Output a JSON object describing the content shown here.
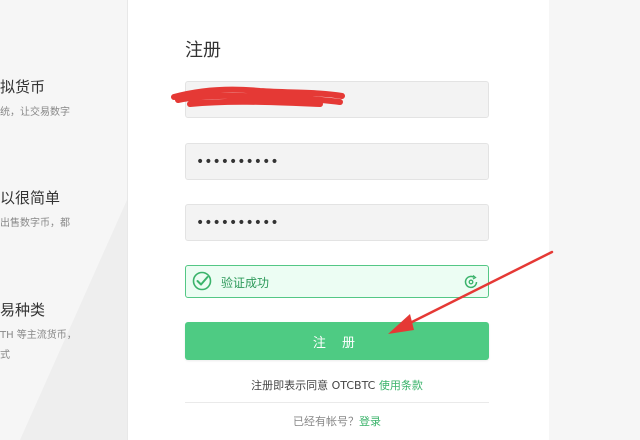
{
  "left_panel": {
    "features": [
      {
        "title": "拟货币",
        "desc": "统，让交易数字"
      },
      {
        "title": "以很简单",
        "desc": "出售数字币，都"
      },
      {
        "title": "易种类",
        "desc_lines": [
          "TH 等主流货币，",
          "式"
        ]
      }
    ]
  },
  "form": {
    "title": "注册",
    "username_redacted": true,
    "password_mask": "••••••••••",
    "confirm_password_mask": "••••••••••",
    "captcha": {
      "status_text": "验证成功",
      "state": "success"
    },
    "submit_label": "注 册",
    "agree_prefix": "注册即表示同意 OTCBTC ",
    "agree_link": "使用条款",
    "login_prefix": "已经有帐号？",
    "login_link": "登录"
  },
  "colors": {
    "accent_green": "#4ecb83",
    "link_green": "#3bb36b",
    "annotation_red": "#e53935"
  }
}
